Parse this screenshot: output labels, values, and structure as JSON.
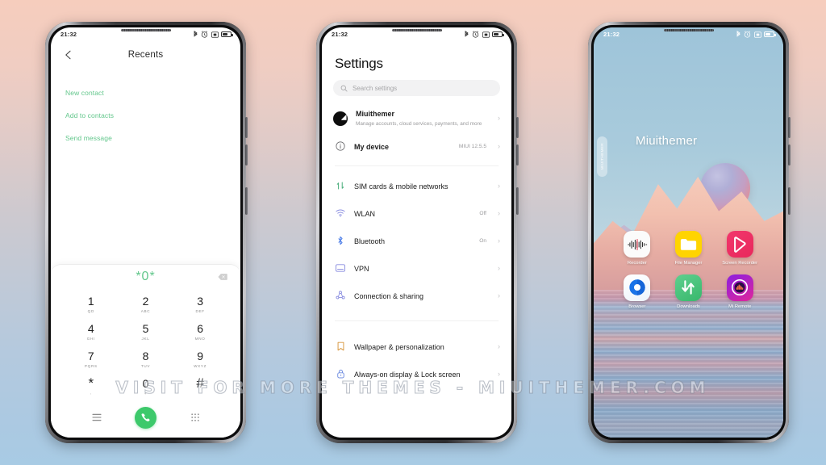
{
  "background": {
    "top_color": "#f6cdbd",
    "bottom_color": "#a8cbe4"
  },
  "watermark": {
    "text": "VISIT FOR MORE THEMES - MIUITHEMER.COM"
  },
  "accent": {
    "green": "#3dc96b",
    "light_green": "#63c78c"
  },
  "status_bar": {
    "time": "21:32",
    "icons": [
      "bluetooth-icon",
      "alarm-icon",
      "dnd-icon",
      "battery-icon"
    ]
  },
  "phone1": {
    "app_bar": {
      "back_label": "back-arrow",
      "title": "Recents"
    },
    "actions": [
      {
        "label": "New contact"
      },
      {
        "label": "Add to contacts"
      },
      {
        "label": "Send message"
      }
    ],
    "dialer": {
      "display": "*0*",
      "backspace": "backspace-icon",
      "keys": [
        {
          "digit": "1",
          "letters": "QD"
        },
        {
          "digit": "2",
          "letters": "ABC"
        },
        {
          "digit": "3",
          "letters": "DEF"
        },
        {
          "digit": "4",
          "letters": "GHI"
        },
        {
          "digit": "5",
          "letters": "JKL"
        },
        {
          "digit": "6",
          "letters": "MNO"
        },
        {
          "digit": "7",
          "letters": "PQRS"
        },
        {
          "digit": "8",
          "letters": "TUV"
        },
        {
          "digit": "9",
          "letters": "WXYZ"
        },
        {
          "digit": "*",
          "letters": ","
        },
        {
          "digit": "0",
          "letters": "+"
        },
        {
          "digit": "#",
          "letters": ""
        }
      ],
      "bottom_bar": {
        "menu": "menu-icon",
        "call": "call-icon",
        "keypad": "keypad-icon"
      }
    }
  },
  "phone2": {
    "title": "Settings",
    "search": {
      "placeholder": "Search settings",
      "icon": "search-icon"
    },
    "account": {
      "name": "Miuithemer",
      "subtitle": "Manage accounts, cloud services, payments, and more"
    },
    "rows": [
      {
        "label": "My device",
        "value": "MIUI 12.5.5",
        "icon": "info-icon"
      },
      {
        "label": "SIM cards & mobile networks",
        "value": "",
        "icon": "sim-icon"
      },
      {
        "label": "WLAN",
        "value": "Off",
        "icon": "wifi-icon"
      },
      {
        "label": "Bluetooth",
        "value": "On",
        "icon": "bluetooth-icon"
      },
      {
        "label": "VPN",
        "value": "",
        "icon": "vpn-icon"
      },
      {
        "label": "Connection & sharing",
        "value": "",
        "icon": "share-icon"
      },
      {
        "label": "Wallpaper & personalization",
        "value": "",
        "icon": "wallpaper-icon"
      },
      {
        "label": "Always-on display & Lock screen",
        "value": "",
        "icon": "lock-icon"
      }
    ]
  },
  "phone3": {
    "wallpaper_label": "Miuithemer",
    "side_widget_text": "MIUITHEMER",
    "apps": [
      {
        "name": "Recorder",
        "icon": "recorder-icon"
      },
      {
        "name": "File Manager",
        "icon": "folder-icon"
      },
      {
        "name": "Screen Recorder",
        "icon": "screen-recorder-icon"
      },
      {
        "name": "Browser",
        "icon": "browser-icon"
      },
      {
        "name": "Downloads",
        "icon": "downloads-icon"
      },
      {
        "name": "Mi Remote",
        "icon": "remote-icon"
      }
    ]
  }
}
